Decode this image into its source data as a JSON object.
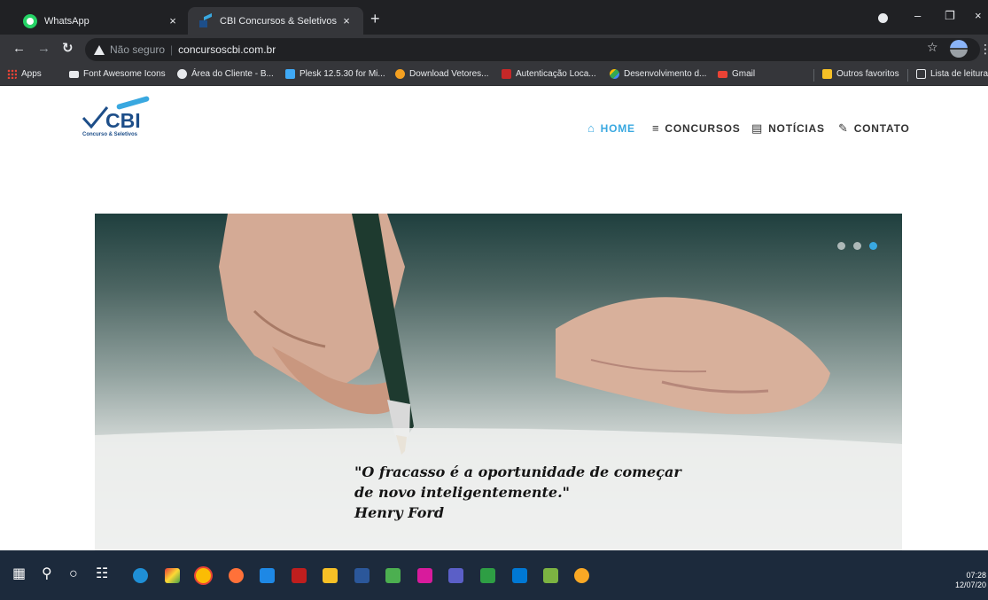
{
  "browser": {
    "tabs": [
      {
        "title": "WhatsApp",
        "active": false,
        "icon": "whatsapp-icon"
      },
      {
        "title": "CBI Concursos & Seletivos",
        "active": true,
        "icon": "cbi-favicon"
      }
    ],
    "new_tab_label": "+",
    "close_glyph": "×",
    "address": {
      "security_label": "Não seguro",
      "url": "concursoscbi.com.br"
    },
    "bookmarks": [
      {
        "label": "Apps",
        "icon": "apps-grid-icon"
      },
      {
        "label": "Font Awesome Icons",
        "icon": "flag-icon"
      },
      {
        "label": "Área do Cliente - B...",
        "icon": "globe-icon"
      },
      {
        "label": "Plesk 12.5.30 for Mi...",
        "icon": "plesk-icon"
      },
      {
        "label": "Download Vetores...",
        "icon": "freepik-icon"
      },
      {
        "label": "Autenticação Loca...",
        "icon": "w-icon"
      },
      {
        "label": "Desenvolvimento d...",
        "icon": "drive-icon"
      },
      {
        "label": "Gmail",
        "icon": "gmail-icon"
      }
    ],
    "bookmarks_right": [
      {
        "label": "Outros favoritos",
        "icon": "folder-icon"
      },
      {
        "label": "Lista de leitura",
        "icon": "reading-list-icon"
      }
    ]
  },
  "site": {
    "logo": {
      "name": "CBI",
      "tagline": "Concurso & Seletivos"
    },
    "nav": [
      {
        "label": "HOME",
        "icon": "home-icon",
        "active": true
      },
      {
        "label": "CONCURSOS",
        "icon": "layers-icon",
        "active": false
      },
      {
        "label": "NOTÍCIAS",
        "icon": "newspaper-icon",
        "active": false
      },
      {
        "label": "CONTATO",
        "icon": "edit-icon",
        "active": false
      }
    ],
    "slider": {
      "quote_line1": "\"O fracasso é a oportunidade de começar",
      "quote_line2": "de novo inteligentemente.\"",
      "quote_author": "Henry Ford",
      "slide_count": 3,
      "active_slide": 3
    }
  },
  "taskbar": {
    "time": "07:28",
    "date": "12/07/20",
    "colors": {
      "background": "#1c2a3c",
      "accent": "#39a8e0"
    }
  }
}
